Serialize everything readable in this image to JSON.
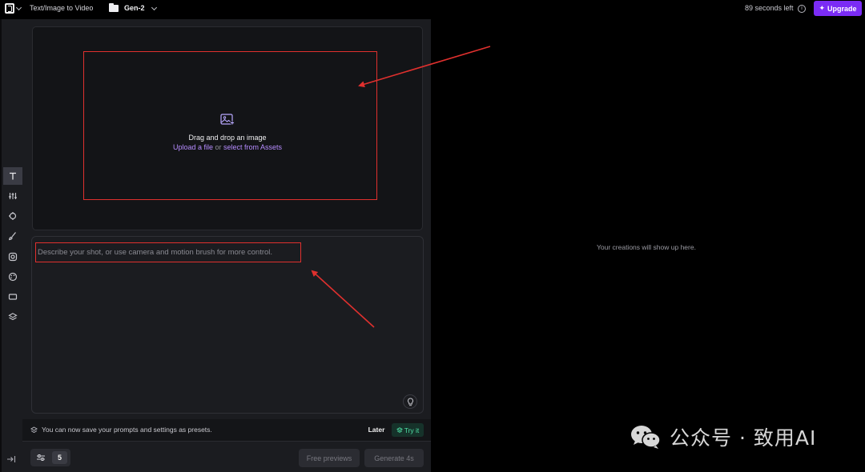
{
  "header": {
    "app_title": "Text/Image to Video",
    "project_name": "Gen-2",
    "time_left": "89 seconds left",
    "info_icon": "info-icon",
    "upgrade_label": "Upgrade",
    "accent_color": "#7b2cf5"
  },
  "rail": {
    "items": [
      {
        "name": "text-mode",
        "icon": "text-t-icon",
        "active": true
      },
      {
        "name": "sliders",
        "icon": "sliders-icon",
        "active": false
      },
      {
        "name": "camera",
        "icon": "camera-control-icon",
        "active": false
      },
      {
        "name": "motion-brush",
        "icon": "brush-icon",
        "active": false
      },
      {
        "name": "settings",
        "icon": "gear-icon",
        "active": false
      },
      {
        "name": "style",
        "icon": "palette-icon",
        "active": false
      },
      {
        "name": "aspect-ratio",
        "icon": "aspect-ratio-icon",
        "active": false
      },
      {
        "name": "layers",
        "icon": "layers-icon",
        "active": false
      }
    ],
    "collapse_icon": "collapse-panel-icon"
  },
  "upload": {
    "title": "Drag and drop an image",
    "upload_link": "Upload a file",
    "or_text": " or ",
    "assets_link": "select from Assets",
    "icon": "image-upload-icon"
  },
  "prompt": {
    "placeholder": "Describe your shot, or use camera and motion brush for more control.",
    "value": "",
    "idea_icon": "lightbulb-icon"
  },
  "presets": {
    "message": "You can now save your prompts and settings as presets.",
    "later_label": "Later",
    "try_label": "Try it",
    "accent_color": "#4fe0a5"
  },
  "footer": {
    "settings_count": "5",
    "free_previews_label": "Free previews",
    "generate_label": "Generate 4s"
  },
  "output": {
    "empty_message": "Your creations will show up here."
  },
  "watermark": {
    "text": "公众号 · 致用AI"
  }
}
